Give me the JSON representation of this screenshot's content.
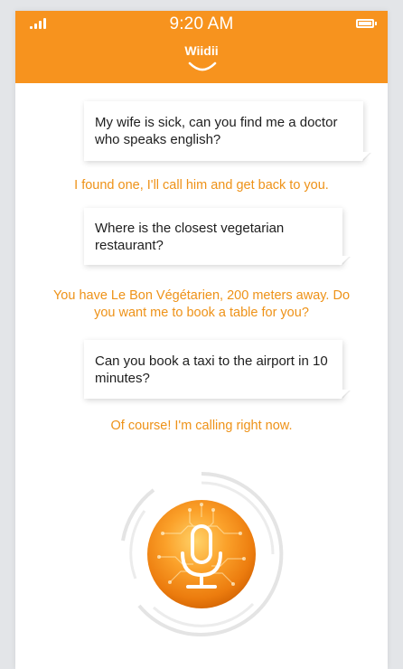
{
  "status_bar": {
    "time": "9:20 AM"
  },
  "header": {
    "logo_text": "Wiidii"
  },
  "conversation": [
    {
      "role": "user",
      "text": "My wife is sick, can you find me a doctor who speaks english?"
    },
    {
      "role": "assistant",
      "text": "I found one, I'll call him and get back to you."
    },
    {
      "role": "user",
      "text": "Where is the closest vegetarian restaurant?"
    },
    {
      "role": "assistant",
      "text": "You have Le Bon Végétarien, 200 meters away. Do you want me to book a table for you?"
    },
    {
      "role": "user",
      "text": "Can you book a taxi to the airport in 10 minutes?"
    },
    {
      "role": "assistant",
      "text": "Of course! I'm calling right now."
    }
  ],
  "mic_button": {
    "icon": "microphone-icon"
  },
  "colors": {
    "brand_orange": "#f7931e",
    "reply_text": "#ee9218",
    "bubble_bg": "#ffffff"
  }
}
